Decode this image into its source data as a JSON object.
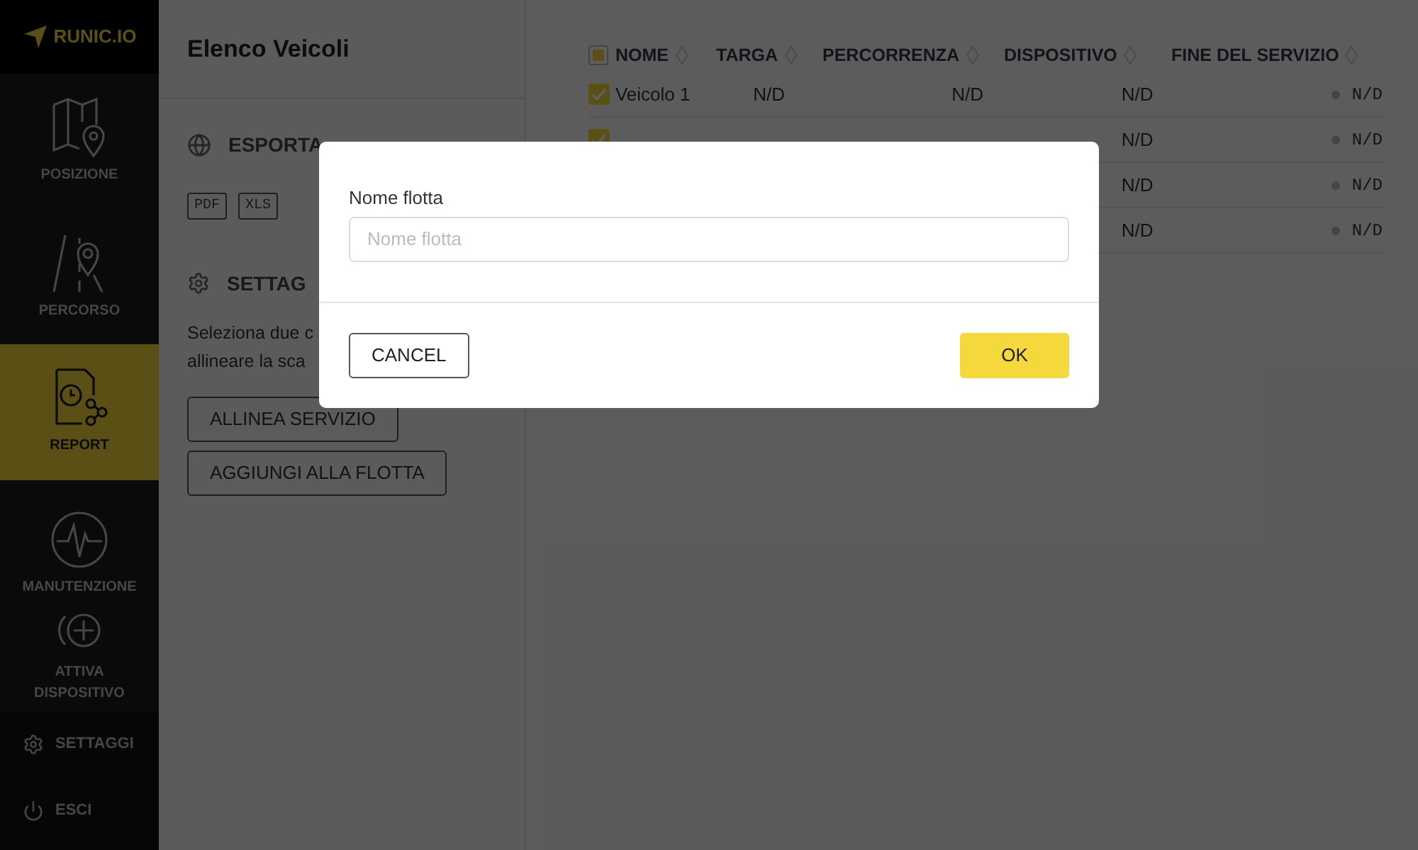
{
  "logo": {
    "text": "RUNIC.IO"
  },
  "nav": [
    {
      "kind": "map",
      "label": "POSIZIONE",
      "selected": false
    },
    {
      "kind": "road",
      "label": "PERCORSO",
      "selected": false
    },
    {
      "kind": "report",
      "label": "REPORT",
      "selected": true
    },
    {
      "kind": "pulse",
      "label": "MANUTENZIONE",
      "selected": false
    },
    {
      "kind": "add",
      "label": "ATTIVA DISPOSITIVO",
      "selected": false
    }
  ],
  "bottom_nav": [
    {
      "kind": "gear",
      "label": "SETTAGGI"
    },
    {
      "kind": "power",
      "label": "ESCI"
    }
  ],
  "panel": {
    "title": "Elenco Veicoli",
    "export": {
      "heading": "ESPORTA",
      "formats": [
        "PDF",
        "XLS"
      ]
    },
    "settings": {
      "heading": "SETTAG",
      "text_lines": [
        "Seleziona due c",
        "allineare la sca"
      ],
      "buttons": [
        "ALLINEA SERVIZIO",
        "AGGIUNGI ALLA FLOTTA"
      ]
    }
  },
  "table": {
    "header_checkbox": {
      "partial": true
    },
    "columns": [
      "NOME",
      "TARGA",
      "PERCORRENZA",
      "DISPOSITIVO",
      "FINE DEL SERVIZIO"
    ],
    "rows": [
      {
        "checked": true,
        "cells": [
          "Veicolo 1",
          "N/D",
          "N/D",
          "N/D",
          "N/D"
        ]
      },
      {
        "checked": true,
        "cells": [
          null,
          null,
          null,
          "N/D",
          "N/D"
        ]
      },
      {
        "cells": [
          null,
          null,
          null,
          "N/D",
          "N/D"
        ]
      },
      {
        "cells": [
          null,
          null,
          null,
          "N/D",
          "N/D"
        ]
      }
    ]
  },
  "dialog": {
    "label": "Nome flotta",
    "placeholder": "Nome flotta",
    "cancel": "CANCEL",
    "ok": "OK"
  }
}
